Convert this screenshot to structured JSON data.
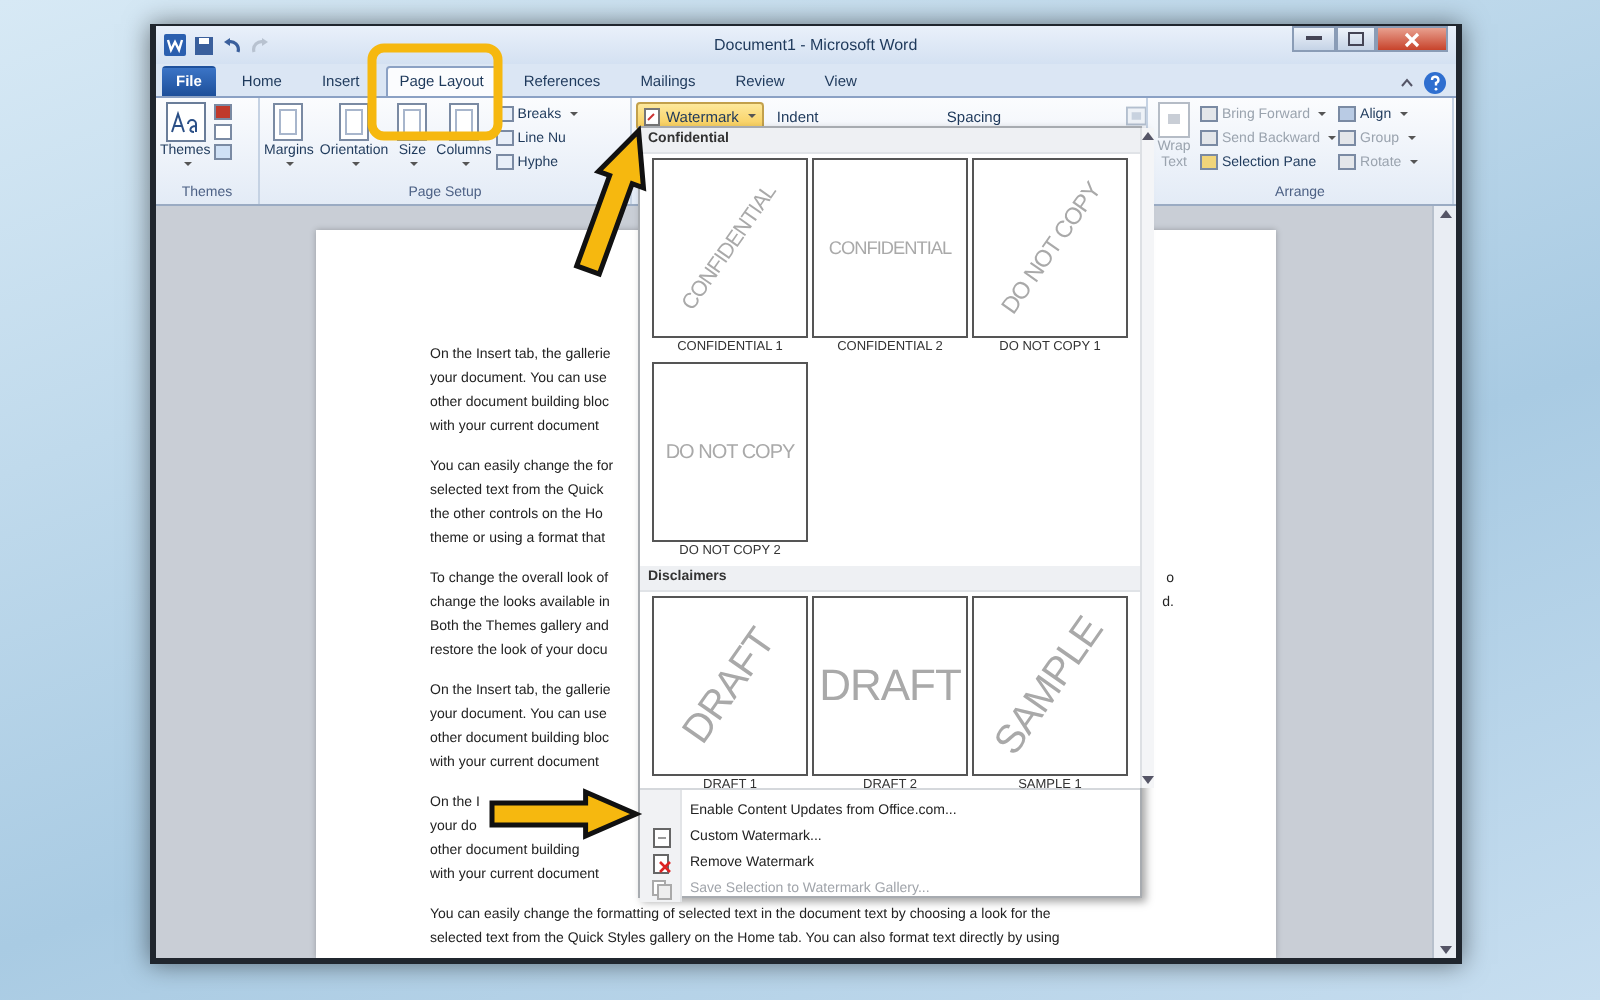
{
  "window": {
    "title": "Document1 - Microsoft Word"
  },
  "tabs": [
    {
      "label": "File",
      "kind": "file",
      "selected": false
    },
    {
      "label": "Home",
      "kind": "tab",
      "selected": false
    },
    {
      "label": "Insert",
      "kind": "tab",
      "selected": false
    },
    {
      "label": "Page Layout",
      "kind": "tab",
      "selected": true
    },
    {
      "label": "References",
      "kind": "tab",
      "selected": false
    },
    {
      "label": "Mailings",
      "kind": "tab",
      "selected": false
    },
    {
      "label": "Review",
      "kind": "tab",
      "selected": false
    },
    {
      "label": "View",
      "kind": "tab",
      "selected": false
    }
  ],
  "ribbon": {
    "themes": {
      "label": "Themes",
      "button": "Themes"
    },
    "page_setup": {
      "label": "Page Setup",
      "large_buttons": [
        "Margins",
        "Orientation",
        "Size",
        "Columns"
      ],
      "small_buttons": [
        {
          "label": "Breaks",
          "menu": true
        },
        {
          "label": "Line Nu",
          "menu": false
        },
        {
          "label": "Hyphe",
          "menu": false
        }
      ]
    },
    "watermark_button": {
      "label": "Watermark",
      "open": true
    },
    "paragraph_headers": [
      "Indent",
      "Spacing"
    ],
    "arrange": {
      "label": "Arrange",
      "wrap_text": {
        "label": "Wrap Text",
        "disabled": true
      },
      "buttons": [
        {
          "label": "Bring Forward",
          "disabled": true,
          "menu": true
        },
        {
          "label": "Send Backward",
          "disabled": true,
          "menu": true
        },
        {
          "label": "Selection Pane",
          "disabled": false,
          "menu": false
        },
        {
          "label": "Align",
          "disabled": false,
          "menu": true
        },
        {
          "label": "Group",
          "disabled": true,
          "menu": true
        },
        {
          "label": "Rotate",
          "disabled": true,
          "menu": true
        }
      ]
    }
  },
  "watermark_menu": {
    "sections": [
      {
        "title": "Confidential",
        "items": [
          {
            "caption": "CONFIDENTIAL 1",
            "watermark": "CONFIDENTIAL",
            "kind": "diagonal"
          },
          {
            "caption": "CONFIDENTIAL 2",
            "watermark": "CONFIDENTIAL",
            "kind": "horizontal"
          },
          {
            "caption": "DO NOT COPY 1",
            "watermark": "DO NOT COPY",
            "kind": "diagonal"
          },
          {
            "caption": "DO NOT COPY 2",
            "watermark": "DO NOT COPY",
            "kind": "horizontal"
          }
        ]
      },
      {
        "title": "Disclaimers",
        "items": [
          {
            "caption": "DRAFT 1",
            "watermark": "DRAFT",
            "kind": "diagonal"
          },
          {
            "caption": "DRAFT 2",
            "watermark": "DRAFT",
            "kind": "horizontal"
          },
          {
            "caption": "SAMPLE 1",
            "watermark": "SAMPLE",
            "kind": "diagonal"
          }
        ]
      }
    ],
    "commands": [
      {
        "label": "Enable Content Updates from Office.com...",
        "kind": "none",
        "disabled": false
      },
      {
        "label": "Custom Watermark...",
        "kind": "custom",
        "disabled": false
      },
      {
        "label": "Remove Watermark",
        "kind": "remove",
        "disabled": false
      },
      {
        "label": "Save Selection to Watermark Gallery...",
        "kind": "save",
        "disabled": true
      }
    ]
  },
  "document": {
    "paragraphs": [
      {
        "lines": [
          {
            "text": "On the Insert tab, the gallerie"
          },
          {
            "text": "your document. You can use"
          },
          {
            "text": "other document building bloc"
          },
          {
            "text": "with your current document"
          }
        ]
      },
      {
        "lines": [
          {
            "text": "You can easily change the for"
          },
          {
            "text": "selected text from the Quick"
          },
          {
            "text": "the other controls on the Ho"
          },
          {
            "text": "theme or using a format that"
          }
        ]
      },
      {
        "lines": [
          {
            "text": "To change the overall look of",
            "tail": "o"
          },
          {
            "text": "change the looks available in",
            "tail": "d."
          },
          {
            "text": "Both the Themes gallery and"
          },
          {
            "text": "restore the look of your docu"
          }
        ]
      },
      {
        "lines": [
          {
            "text": "On the Insert tab, the gallerie"
          },
          {
            "text": "your document. You can use"
          },
          {
            "text": "other document building bloc"
          },
          {
            "text": "with your current document"
          }
        ]
      },
      {
        "lines": [
          {
            "text": "On the I"
          },
          {
            "text": "your do"
          },
          {
            "text": "other document building"
          },
          {
            "text": "with your current document"
          }
        ]
      },
      {
        "lines": [
          {
            "text": "You can easily change the formatting of selected text in the document text by choosing a look for the"
          },
          {
            "text": "selected text from the Quick Styles gallery on the Home tab. You can also format text directly by using"
          }
        ]
      }
    ]
  }
}
